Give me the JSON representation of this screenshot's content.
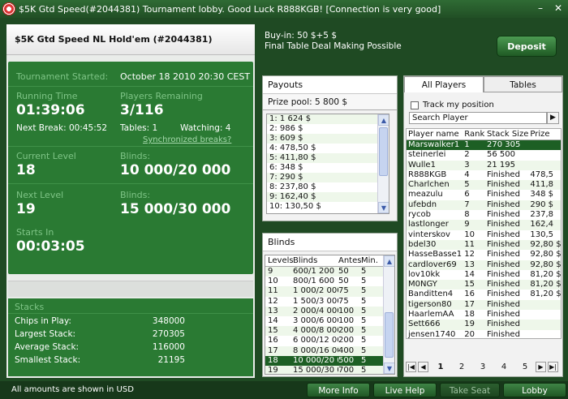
{
  "window": {
    "title": "$5K Gtd Speed(#2044381) Tournament lobby. Good Luck R888KGB!    [Connection is very good]"
  },
  "tournament": {
    "name": "$5K Gtd Speed NL Hold'em (#2044381)",
    "started_label": "Tournament Started:",
    "started_value": "October 18 2010  20:30 CEST",
    "running_label": "Running Time",
    "running_value": "01:39:06",
    "players_label": "Players Remaining",
    "players_value": "3/116",
    "next_break": "Next Break: 00:45:52",
    "tables": "Tables: 1",
    "watching": "Watching: 4",
    "sync_breaks": "Synchronized breaks?",
    "current_level_label": "Current Level",
    "current_level_value": "18",
    "current_blinds_label": "Blinds:",
    "current_blinds_value": "10 000/20 000",
    "next_level_label": "Next Level",
    "next_level_value": "19",
    "next_blinds_label": "Blinds:",
    "next_blinds_value": "15 000/30 000",
    "starts_in_label": "Starts In",
    "starts_in_value": "00:03:05"
  },
  "stacks": {
    "title": "Stacks",
    "rows": [
      {
        "label": "Chips in Play:",
        "value": "348000"
      },
      {
        "label": "Largest Stack:",
        "value": "270305"
      },
      {
        "label": "Average Stack:",
        "value": "116000"
      },
      {
        "label": "Smallest Stack:",
        "value": "21195"
      }
    ]
  },
  "buyin": {
    "line1": "Buy-in: 50 $+5 $",
    "line2": "Final Table Deal Making Possible",
    "deposit_label": "Deposit"
  },
  "payouts": {
    "title": "Payouts",
    "prize_pool": "Prize pool: 5 800 $",
    "rows": [
      "1: 1 624 $",
      "2: 986 $",
      "3: 609 $",
      "4: 478,50 $",
      "5: 411,80 $",
      "6: 348 $",
      "7: 290 $",
      "8: 237,80 $",
      "9: 162,40 $",
      "10: 130,50 $"
    ]
  },
  "blinds": {
    "title": "Blinds",
    "headers": [
      "Levels",
      "Blinds",
      "Antes",
      "Min."
    ],
    "rows": [
      [
        "9",
        "600/1 200",
        "50",
        "5"
      ],
      [
        "10",
        "800/1 600",
        "50",
        "5"
      ],
      [
        "11",
        "1 000/2 000",
        "75",
        "5"
      ],
      [
        "12",
        "1 500/3 000",
        "75",
        "5"
      ],
      [
        "13",
        "2 000/4 000",
        "100",
        "5"
      ],
      [
        "14",
        "3 000/6 000",
        "100",
        "5"
      ],
      [
        "15",
        "4 000/8 000",
        "200",
        "5"
      ],
      [
        "16",
        "6 000/12 000",
        "200",
        "5"
      ],
      [
        "17",
        "8 000/16 000",
        "400",
        "5"
      ],
      [
        "18",
        "10 000/20 000",
        "500",
        "5"
      ],
      [
        "19",
        "15 000/30 000",
        "700",
        "5"
      ]
    ],
    "selected_level": "18"
  },
  "players": {
    "tab_all": "All Players",
    "tab_tables": "Tables",
    "track_label": "Track my position",
    "search_placeholder": "Search Player",
    "headers": [
      "Player name",
      "Rank",
      "Stack Size",
      "Prize"
    ],
    "rows": [
      [
        "Marswalker1",
        "1",
        "270 305",
        ""
      ],
      [
        "steinerlei",
        "2",
        "56 500",
        ""
      ],
      [
        "Wulle1",
        "3",
        "21 195",
        ""
      ],
      [
        "R888KGB",
        "4",
        "Finished",
        "478,5"
      ],
      [
        "Charlchen",
        "5",
        "Finished",
        "411,8"
      ],
      [
        "meazulu",
        "6",
        "Finished",
        "348 $"
      ],
      [
        "ufebdn",
        "7",
        "Finished",
        "290 $"
      ],
      [
        "rycob",
        "8",
        "Finished",
        "237,8"
      ],
      [
        "lastlonger",
        "9",
        "Finished",
        "162,4"
      ],
      [
        "vinterskov",
        "10",
        "Finished",
        "130,5"
      ],
      [
        "bdel30",
        "11",
        "Finished",
        "92,80 $"
      ],
      [
        "HasseBasse1",
        "12",
        "Finished",
        "92,80 $"
      ],
      [
        "cardlover69",
        "13",
        "Finished",
        "92,80 $"
      ],
      [
        "lov10kk",
        "14",
        "Finished",
        "81,20 $"
      ],
      [
        "M0NGY",
        "15",
        "Finished",
        "81,20 $"
      ],
      [
        "Banditten4",
        "16",
        "Finished",
        "81,20 $"
      ],
      [
        "tigerson80",
        "17",
        "Finished",
        ""
      ],
      [
        "HaarlemAA",
        "18",
        "Finished",
        ""
      ],
      [
        "Sett666",
        "19",
        "Finished",
        ""
      ],
      [
        "jensen1740",
        "20",
        "Finished",
        ""
      ]
    ],
    "pages": [
      "1",
      "2",
      "3",
      "4",
      "5"
    ]
  },
  "bottom": {
    "note": "All amounts are shown in USD",
    "more_info": "More Info",
    "live_help": "Live Help",
    "take_seat": "Take Seat",
    "lobby": "Lobby"
  }
}
